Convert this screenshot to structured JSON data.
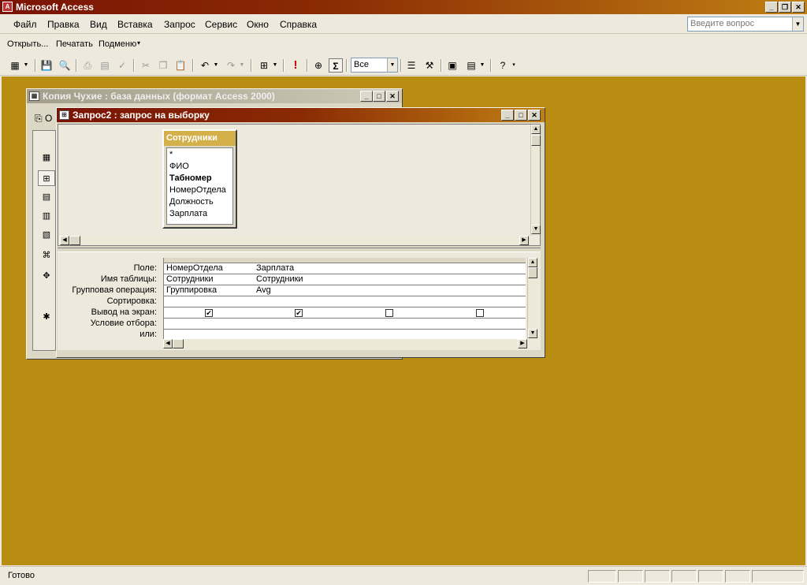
{
  "app": {
    "title": "Microsoft Access"
  },
  "menu": {
    "items": [
      "Файл",
      "Правка",
      "Вид",
      "Вставка",
      "Запрос",
      "Сервис",
      "Окно",
      "Справка"
    ],
    "ask_placeholder": "Введите вопрос"
  },
  "toolbar_web": {
    "open": "Открыть...",
    "print": "Печатать",
    "submenu": "Подменю"
  },
  "toolbar_query": {
    "top_values": "Все",
    "totals_symbol": "Σ",
    "run_symbol": "!"
  },
  "db_window": {
    "title": "Копия Чухие : база данных (формат Access 2000)",
    "open_short": "О"
  },
  "query_window": {
    "title": "Запрос2 : запрос на выборку",
    "table": {
      "name": "Сотрудники",
      "fields": [
        "*",
        "ФИО",
        "Табномер",
        "НомерОтдела",
        "Должность",
        "Зарплата"
      ],
      "key_field": "Табномер"
    },
    "grid": {
      "row_labels": [
        "Поле:",
        "Имя таблицы:",
        "Групповая операция:",
        "Сортировка:",
        "Вывод на экран:",
        "Условие отбора:",
        "или:"
      ],
      "columns": [
        {
          "field": "НомерОтдела",
          "table": "Сотрудники",
          "total": "Группировка",
          "sort": "",
          "show": true,
          "criteria": "",
          "or": ""
        },
        {
          "field": "Зарплата",
          "table": "Сотрудники",
          "total": "Avg",
          "sort": "",
          "show": true,
          "criteria": "",
          "or": ""
        },
        {
          "field": "",
          "table": "",
          "total": "",
          "sort": "",
          "show": false,
          "criteria": "",
          "or": ""
        },
        {
          "field": "",
          "table": "",
          "total": "",
          "sort": "",
          "show": false,
          "criteria": "",
          "or": ""
        }
      ]
    }
  },
  "status": {
    "text": "Готово"
  },
  "colors": {
    "title_active": "#7a1305",
    "desktop": "#b98c12",
    "table_header": "#d4b04a"
  }
}
